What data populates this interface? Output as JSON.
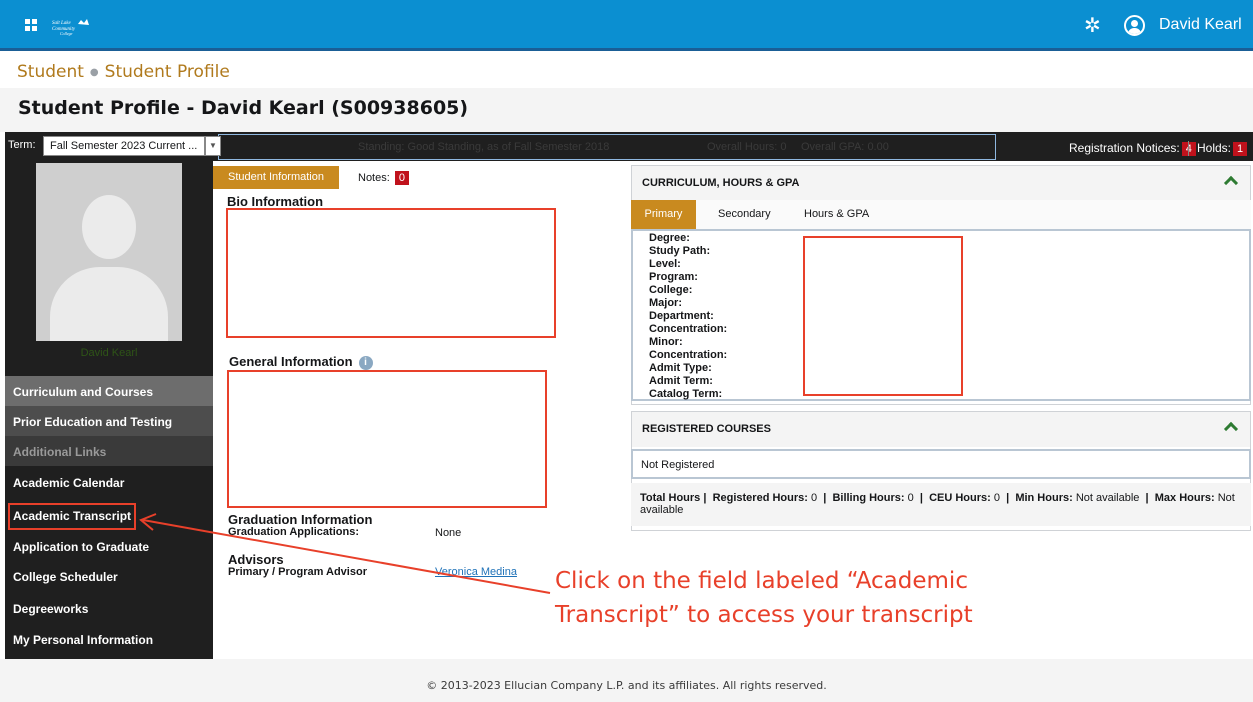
{
  "header": {
    "user_name": "David Kearl",
    "grid_icon": "grid-menu-icon",
    "logo_text": "Salt Lake Community College",
    "settings_icon": "gear-icon",
    "user_icon": "user-circle-icon",
    "bg_color": "#0b8fd1"
  },
  "breadcrumb": {
    "item1": "Student",
    "item2": "Student Profile"
  },
  "page": {
    "title": "Student Profile - David Kearl (S00938605)"
  },
  "termbar": {
    "term_label": "Term:",
    "term_value": "Fall Semester 2023 Current ...",
    "standing_label": "Standing:",
    "standing_value": "Good Standing, as of Fall Semester 2018",
    "overall_hours_label": "Overall Hours:",
    "overall_hours_value": "0",
    "overall_gpa_label": "Overall GPA:",
    "overall_gpa_value": "0.00",
    "reg_notices_label": "Registration Notices:",
    "reg_notices_count": "4",
    "holds_label": "Holds:",
    "holds_count": "1"
  },
  "sidebar": {
    "student_name": "David Kearl",
    "items": [
      {
        "label": "Curriculum and Courses"
      },
      {
        "label": "Prior Education and Testing"
      },
      {
        "label": "Additional Links"
      },
      {
        "label": "Academic Calendar"
      },
      {
        "label": "Academic Transcript"
      },
      {
        "label": "Application to Graduate"
      },
      {
        "label": "College Scheduler"
      },
      {
        "label": "Degreeworks"
      },
      {
        "label": "My Personal Information"
      }
    ]
  },
  "main": {
    "tab_student_info": "Student Information",
    "tab_notes": "Notes:",
    "notes_count": "0",
    "bio_heading": "Bio Information",
    "general_heading": "General Information",
    "graduation_heading": "Graduation Information",
    "graduation_label": "Graduation Applications:",
    "graduation_value": "None",
    "advisors_heading": "Advisors",
    "advisor_label": "Primary / Program Advisor",
    "advisor_name": "Veronica Medina"
  },
  "curriculum": {
    "heading": "CURRICULUM, HOURS & GPA",
    "tabs": [
      "Primary",
      "Secondary",
      "Hours & GPA"
    ],
    "fields": [
      "Degree:",
      "Study Path:",
      "Level:",
      "Program:",
      "College:",
      "Major:",
      "Department:",
      "Concentration:",
      "Minor:",
      "Concentration:",
      "Admit Type:",
      "Admit Term:",
      "Catalog Term:"
    ]
  },
  "registered": {
    "heading": "REGISTERED COURSES",
    "status": "Not Registered",
    "total_hours_label": "Total Hours |",
    "registered_hours_label": "Registered Hours:",
    "registered_hours_value": "0",
    "billing_hours_label": "Billing Hours:",
    "billing_hours_value": "0",
    "ceu_hours_label": "CEU Hours:",
    "ceu_hours_value": "0",
    "min_hours_label": "Min Hours:",
    "min_hours_value": "Not available",
    "max_hours_label": "Max Hours:",
    "max_hours_value": "Not available"
  },
  "annotation": {
    "callout_line1": "Click on the field labeled “Academic",
    "callout_line2": "Transcript” to access your transcript",
    "color": "#e8402a"
  },
  "footer": {
    "text": "© 2013-2023 Ellucian Company L.P. and its affiliates. All rights reserved."
  }
}
